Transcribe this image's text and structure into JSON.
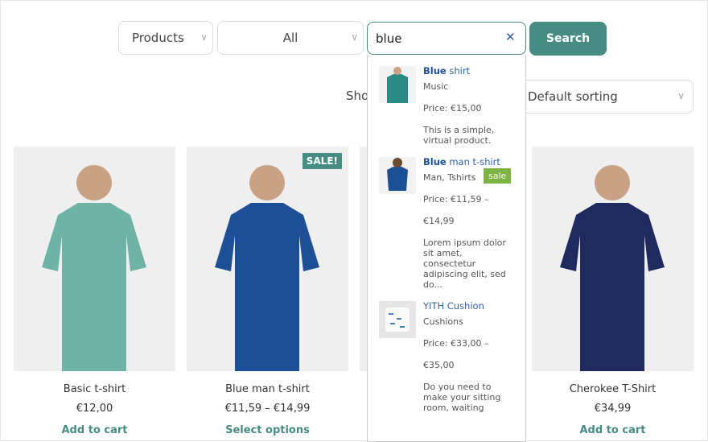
{
  "search": {
    "category": "Products",
    "subcategory": "All",
    "query": "blue",
    "button": "Search",
    "clear_icon": "close-icon"
  },
  "toolbar": {
    "show_label": "Sho",
    "sorting": "Default sorting"
  },
  "colors": {
    "accent": "#468c82",
    "link": "#2f63a3",
    "sale": "#7cb342"
  },
  "results": [
    {
      "match": "Blue",
      "rest": " shirt",
      "category": "Music",
      "price": "Price: €15,00",
      "price2": "",
      "desc": "This is a simple, virtual product.",
      "sale": ""
    },
    {
      "match": "Blue",
      "rest": " man t-shirt",
      "category": "Man, Tshirts",
      "price": "Price: €11,59 –",
      "price2": "€14,99",
      "desc": "Lorem ipsum dolor sit amet, consectetur adipiscing elit, sed do...",
      "sale": "sale"
    },
    {
      "match": "",
      "rest": "YITH Cushion",
      "category": "Cushions",
      "price": "Price: €33,00 –",
      "price2": "€35,00",
      "desc": "Do you need to make your sitting room, waiting",
      "sale": ""
    }
  ],
  "products": [
    {
      "name": "Basic t-shirt",
      "price": "€12,00",
      "action": "Add to cart",
      "badge": "",
      "shirt": "#6fb3a6"
    },
    {
      "name": "Blue man t-shirt",
      "price": "€11,59 – €14,99",
      "action": "Select options",
      "badge": "SALE!",
      "shirt": "#1d4f96"
    },
    {
      "name": "",
      "price": "",
      "action": "",
      "badge": "",
      "shirt": "#cccccc"
    },
    {
      "name": "Cherokee T-Shirt",
      "price": "€34,99",
      "action": "Add to cart",
      "badge": "",
      "shirt": "#1f2a5e"
    }
  ]
}
